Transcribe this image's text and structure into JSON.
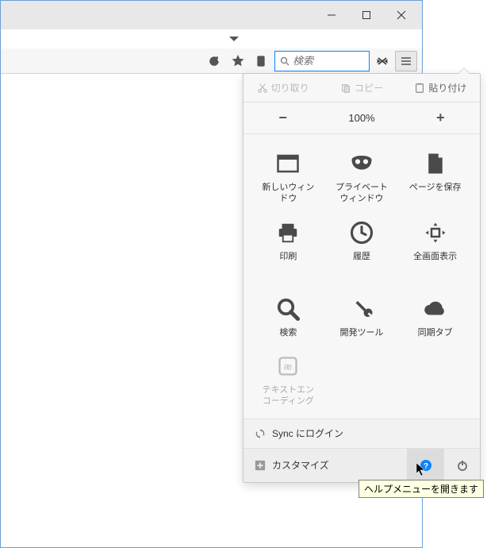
{
  "toolbar": {
    "search_placeholder": "検索"
  },
  "menu": {
    "edit": {
      "cut": "切り取り",
      "copy": "コピー",
      "paste": "貼り付け"
    },
    "zoom": {
      "value": "100%",
      "out": "−",
      "in": "+"
    },
    "grid": {
      "new_window": "新しいウィン\nドウ",
      "private_window": "プライベート\nウィンドウ",
      "save_page": "ページを保存",
      "print": "印刷",
      "history": "履歴",
      "fullscreen": "全画面表示",
      "find": "検索",
      "devtools": "開発ツール",
      "synced_tabs": "同期タブ",
      "text_encoding": "テキストエン\nコーディング"
    },
    "sync": "Sync にログイン",
    "customize": "カスタマイズ"
  },
  "tooltip": "ヘルプメニューを開きます"
}
